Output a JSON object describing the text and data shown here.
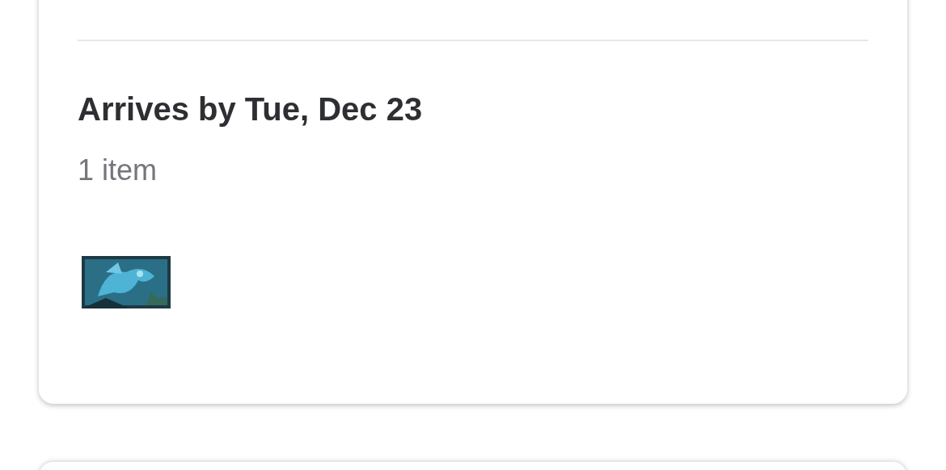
{
  "shipment": {
    "title": "Arrives by Tue, Dec 23",
    "item_count": "1 item"
  }
}
